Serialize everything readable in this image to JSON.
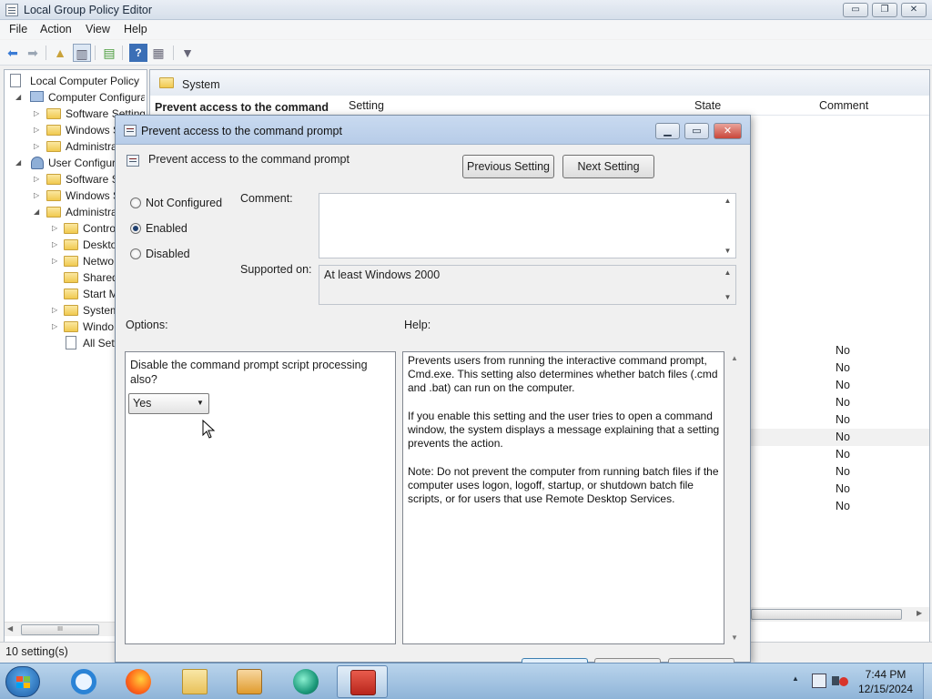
{
  "window": {
    "title": "Local Group Policy Editor",
    "caption": {
      "minimize": "▭",
      "restore": "❐",
      "close": "✕"
    }
  },
  "menu": {
    "file": "File",
    "action": "Action",
    "view": "View",
    "help": "Help"
  },
  "tree": {
    "root": "Local Computer Policy",
    "computer": "Computer Configura",
    "c_software": "Software Settings",
    "c_windows": "Windows S",
    "c_admin": "Administra",
    "user": "User Configurat",
    "u_software": "Software S",
    "u_windows": "Windows S",
    "u_admin": "Administra",
    "control": "Contro",
    "desktop": "Deskto",
    "network": "Netwo",
    "shared": "Shared",
    "start": "Start M",
    "system": "System",
    "windows": "Windo",
    "all": "All Sett",
    "scroll_grip": "III"
  },
  "rightpane": {
    "folder_title": "System",
    "selected_setting": "Prevent access to the command",
    "col_setting": "Setting",
    "col_state": "State",
    "col_comment": "Comment",
    "comment_values": [
      "No",
      "No",
      "No",
      "No",
      "No",
      "No",
      "No",
      "No",
      "No",
      "No"
    ]
  },
  "status": {
    "text": "10 setting(s)"
  },
  "dialog": {
    "title": "Prevent access to the command prompt",
    "setting_name": "Prevent access to the command prompt",
    "prev_button": "Previous Setting",
    "next_button": "Next Setting",
    "radio_not_configured": "Not Configured",
    "radio_enabled": "Enabled",
    "radio_disabled": "Disabled",
    "comment_label": "Comment:",
    "comment_value": "",
    "supported_label": "Supported on:",
    "supported_value": "At least Windows 2000",
    "options_label": "Options:",
    "help_label": "Help:",
    "option_question": "Disable the command prompt script processing also?",
    "option_selected": "Yes",
    "help_text": "Prevents users from running the interactive command prompt, Cmd.exe. This setting also determines whether batch files (.cmd and .bat) can run on the computer.\n\nIf you enable this setting and the user tries to open a command window, the system displays a message explaining that a setting prevents the action.\n\nNote: Do not prevent the computer from running batch files if the computer uses logon, logoff, startup, or shutdown batch file scripts, or for users that use Remote Desktop Services."
  },
  "taskbar": {
    "time": "7:44 PM",
    "date": "12/15/2024",
    "tray_up": "▲"
  },
  "colors": {
    "accent": "#1f5ba8",
    "selected_row": "#f1f1f1"
  }
}
